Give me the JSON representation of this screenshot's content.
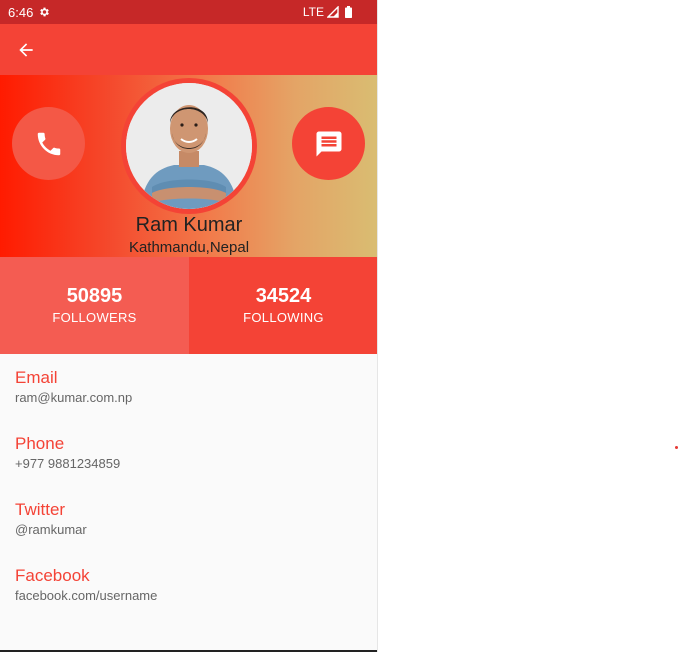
{
  "status_bar": {
    "time": "6:46",
    "network": "LTE",
    "gear_icon": "settings-gear-icon",
    "signal_icon": "signal-icon",
    "battery_icon": "battery-icon"
  },
  "app_bar": {
    "back_icon": "arrow-back-icon"
  },
  "profile": {
    "name": "Ram Kumar",
    "location": "Kathmandu,Nepal",
    "call_icon": "phone-icon",
    "message_icon": "message-icon"
  },
  "stats": {
    "followers": {
      "value": "50895",
      "label": "FOLLOWERS"
    },
    "following": {
      "value": "34524",
      "label": "FOLLOWING"
    }
  },
  "details": [
    {
      "label": "Email",
      "value": "ram@kumar.com.np"
    },
    {
      "label": "Phone",
      "value": "+977 9881234859"
    },
    {
      "label": "Twitter",
      "value": "@ramkumar"
    },
    {
      "label": "Facebook",
      "value": "facebook.com/username"
    }
  ],
  "colors": {
    "primary": "#f44336",
    "status_bar": "#c62828",
    "accent_text": "#f44336"
  }
}
